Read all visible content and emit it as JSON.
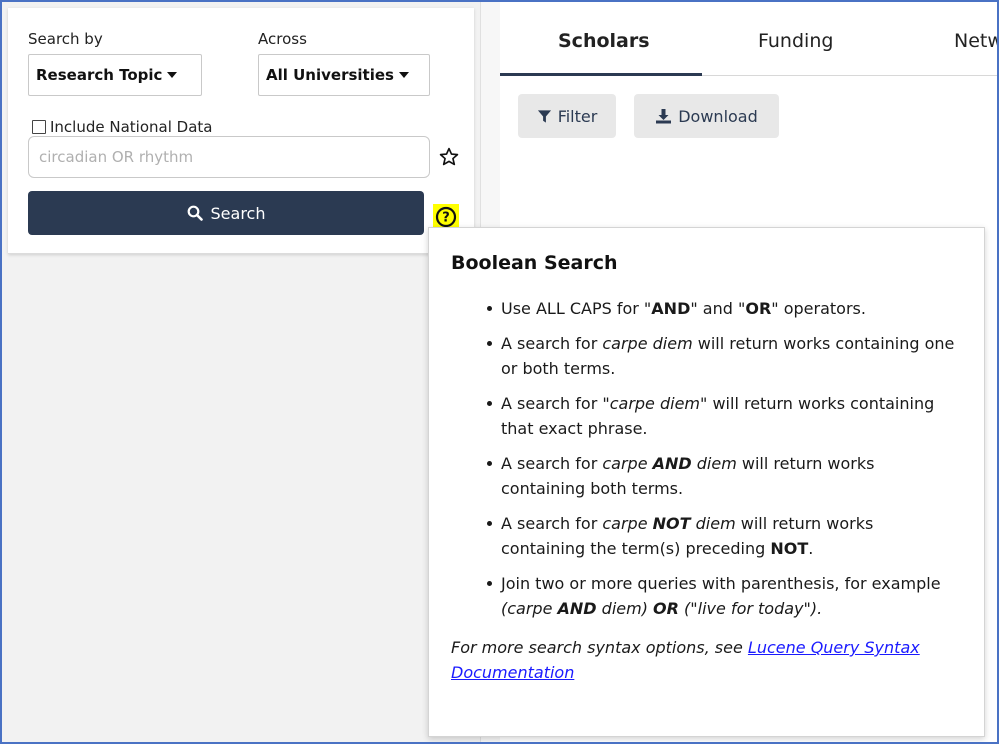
{
  "search_panel": {
    "search_by_label": "Search by",
    "across_label": "Across",
    "search_by_value": "Research Topic",
    "across_value": "All Universities",
    "include_national_label": "Include National Data",
    "include_national_checked": false,
    "search_placeholder": "circadian OR rhythm",
    "search_value": "",
    "search_button_label": "Search"
  },
  "tabs": [
    {
      "label": "Scholars",
      "active": true
    },
    {
      "label": "Funding",
      "active": false
    },
    {
      "label": "Netw",
      "active": false
    }
  ],
  "toolbar": {
    "filter_label": "Filter",
    "download_label": "Download"
  },
  "help_popover": {
    "title": "Boolean Search",
    "items": [
      {
        "parts": [
          [
            "n",
            "Use ALL CAPS for \""
          ],
          [
            "b",
            "AND"
          ],
          [
            "n",
            "\" and \""
          ],
          [
            "b",
            "OR"
          ],
          [
            "n",
            "\" operators."
          ]
        ]
      },
      {
        "parts": [
          [
            "n",
            "A search for "
          ],
          [
            "i",
            "carpe diem"
          ],
          [
            "n",
            " will return works containing one or both terms."
          ]
        ]
      },
      {
        "parts": [
          [
            "n",
            "A search for "
          ],
          [
            "i",
            "\"carpe diem\""
          ],
          [
            "n",
            " will return works containing that exact phrase."
          ]
        ]
      },
      {
        "parts": [
          [
            "n",
            "A search for "
          ],
          [
            "i",
            "carpe "
          ],
          [
            "bi",
            "AND"
          ],
          [
            "i",
            " diem"
          ],
          [
            "n",
            " will return works containing both terms."
          ]
        ]
      },
      {
        "parts": [
          [
            "n",
            "A search for "
          ],
          [
            "i",
            "carpe "
          ],
          [
            "bi",
            "NOT"
          ],
          [
            "i",
            " diem"
          ],
          [
            "n",
            " will return works containing the term(s) preceding "
          ],
          [
            "b",
            "NOT"
          ],
          [
            "n",
            "."
          ]
        ]
      },
      {
        "parts": [
          [
            "n",
            "Join two or more queries with parenthesis, for example "
          ],
          [
            "i",
            "(carpe "
          ],
          [
            "bi",
            "AND"
          ],
          [
            "i",
            " diem) "
          ],
          [
            "bi",
            "OR"
          ],
          [
            "i",
            " (\"live for today\")."
          ]
        ]
      }
    ],
    "footer_text": "For more search syntax options, see ",
    "footer_link": "Lucene Query Syntax Documentation"
  },
  "icons": {
    "star": "star-outline-icon",
    "help": "question-circle-icon",
    "search": "magnifier-icon",
    "filter": "funnel-icon",
    "download": "download-icon"
  },
  "colors": {
    "primary": "#2b3a52",
    "help_highlight": "#ffff00",
    "link": "#1a1aff",
    "frame": "#4a72c4"
  }
}
